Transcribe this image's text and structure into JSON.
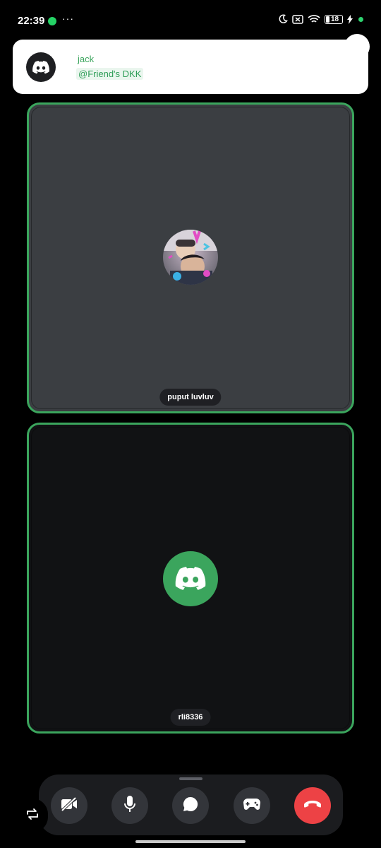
{
  "status_bar": {
    "time": "22:39",
    "more_indicator": "···",
    "battery_level": "18",
    "icons": [
      "whatsapp-icon",
      "moon-icon",
      "sim-icon",
      "wifi-icon",
      "battery-icon",
      "charging-icon"
    ]
  },
  "notification": {
    "app_icon": "discord-logo-icon",
    "title": "jack",
    "subtitle": "@Friend's DKK"
  },
  "tiles": [
    {
      "name": "puput luvluv",
      "speaking": true,
      "avatar": "user-photo"
    },
    {
      "name": "rli8336",
      "speaking": true,
      "avatar": "discord-default-avatar"
    }
  ],
  "controls": {
    "items": [
      "camera-off-icon",
      "microphone-icon",
      "chat-icon",
      "gamepad-icon",
      "hang-up-icon"
    ],
    "flip_icon": "switch-camera-icon"
  },
  "colors": {
    "accent_green": "#3ba55d",
    "hangup_red": "#ed4245",
    "tile_active_bg": "#3b3e42",
    "tile_bg": "#111214"
  }
}
